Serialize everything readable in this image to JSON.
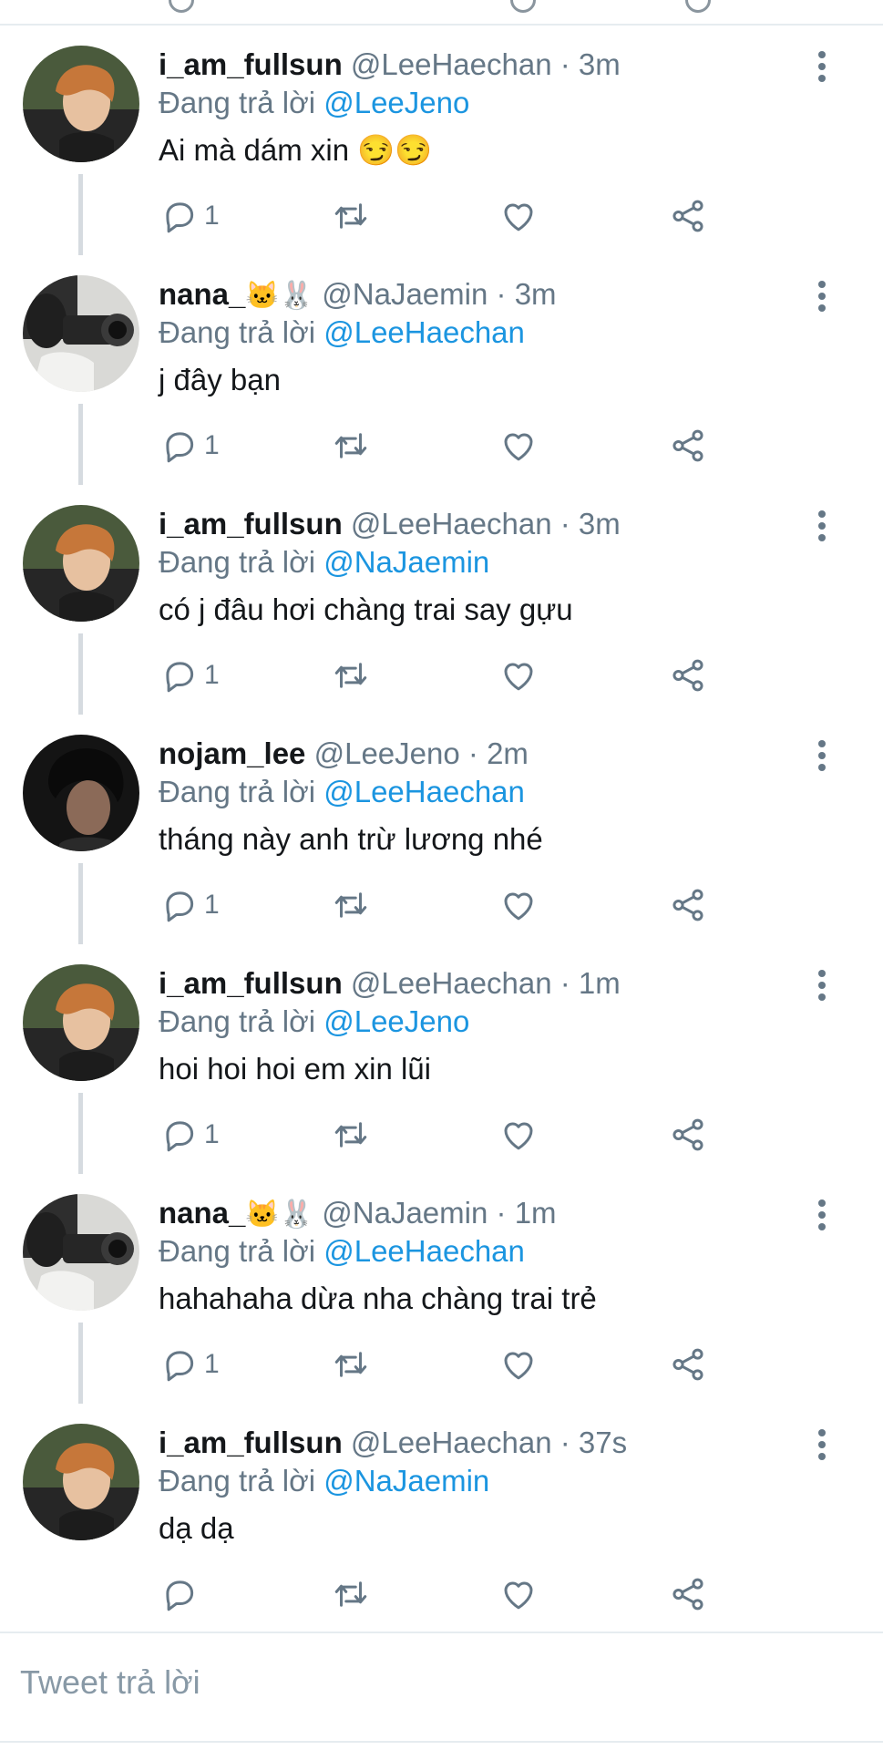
{
  "reply_prefix": "Đang trả lời",
  "dot": "·",
  "composer": {
    "placeholder": "Tweet trả lời"
  },
  "colors": {
    "link": "#1b95e0",
    "muted": "#657786",
    "text": "#14171a",
    "divider": "#e6ecf0"
  },
  "icons": {
    "more": "more-vertical-icon",
    "reply": "reply-icon",
    "retweet": "retweet-icon",
    "like": "heart-icon",
    "share": "share-icon"
  },
  "tweets": [
    {
      "name": "i_am_fullsun",
      "emojis": "",
      "emoji_rabbit": "",
      "handle": "@LeeHaechan",
      "time": "3m",
      "reply_to": "@LeeJeno",
      "text": "Ai mà dám xin 😏😏",
      "reply_count": "1",
      "avatar": "haechan"
    },
    {
      "name": "nana_",
      "emojis": "🐱",
      "emoji_rabbit": "🐰",
      "handle": "@NaJaemin",
      "time": "3m",
      "reply_to": "@LeeHaechan",
      "text": "j đây bạn",
      "reply_count": "1",
      "avatar": "jaemin"
    },
    {
      "name": "i_am_fullsun",
      "emojis": "",
      "emoji_rabbit": "",
      "handle": "@LeeHaechan",
      "time": "3m",
      "reply_to": "@NaJaemin",
      "text": "có j đâu hơi chàng trai say gựu",
      "reply_count": "1",
      "avatar": "haechan"
    },
    {
      "name": "nojam_lee",
      "emojis": "",
      "emoji_rabbit": "",
      "handle": "@LeeJeno",
      "time": "2m",
      "reply_to": "@LeeHaechan",
      "text": "tháng này anh trừ lương nhé",
      "reply_count": "1",
      "avatar": "jeno"
    },
    {
      "name": "i_am_fullsun",
      "emojis": "",
      "emoji_rabbit": "",
      "handle": "@LeeHaechan",
      "time": "1m",
      "reply_to": "@LeeJeno",
      "text": "hoi hoi hoi em xin lũi",
      "reply_count": "1",
      "avatar": "haechan"
    },
    {
      "name": "nana_",
      "emojis": "🐱",
      "emoji_rabbit": "🐰",
      "handle": "@NaJaemin",
      "time": "1m",
      "reply_to": "@LeeHaechan",
      "text": "hahahaha dừa nha chàng trai trẻ",
      "reply_count": "1",
      "avatar": "jaemin"
    },
    {
      "name": "i_am_fullsun",
      "emojis": "",
      "emoji_rabbit": "",
      "handle": "@LeeHaechan",
      "time": "37s",
      "reply_to": "@NaJaemin",
      "text": "dạ dạ",
      "reply_count": "",
      "avatar": "haechan"
    }
  ]
}
